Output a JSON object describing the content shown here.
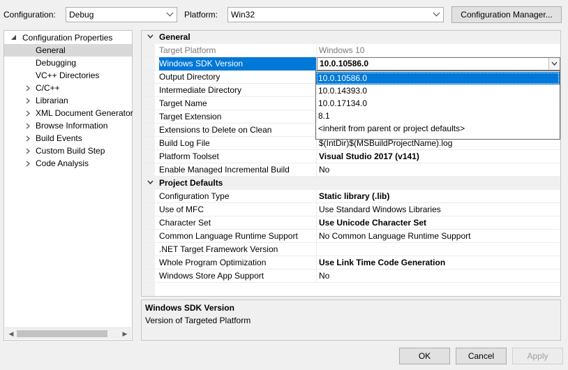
{
  "toolbar": {
    "configuration_label": "Configuration:",
    "configuration_value": "Debug",
    "platform_label": "Platform:",
    "platform_value": "Win32",
    "config_manager_label": "Configuration Manager..."
  },
  "tree": {
    "root": "Configuration Properties",
    "items": [
      {
        "label": "General",
        "selected": true
      },
      {
        "label": "Debugging"
      },
      {
        "label": "VC++ Directories"
      },
      {
        "label": "C/C++"
      },
      {
        "label": "Librarian"
      },
      {
        "label": "XML Document Generator"
      },
      {
        "label": "Browse Information"
      },
      {
        "label": "Build Events"
      },
      {
        "label": "Custom Build Step"
      },
      {
        "label": "Code Analysis"
      }
    ]
  },
  "grid": {
    "general_header": "General",
    "general_rows": [
      {
        "name": "Target Platform",
        "value": "Windows 10"
      },
      {
        "name": "Windows SDK Version",
        "value": "10.0.10586.0"
      },
      {
        "name": "Output Directory",
        "value": ""
      },
      {
        "name": "Intermediate Directory",
        "value": ""
      },
      {
        "name": "Target Name",
        "value": ""
      },
      {
        "name": "Target Extension",
        "value": ""
      },
      {
        "name": "Extensions to Delete on Clean",
        "value": ""
      },
      {
        "name": "Build Log File",
        "value": "$(IntDir)$(MSBuildProjectName).log"
      },
      {
        "name": "Platform Toolset",
        "value": "Visual Studio 2017 (v141)"
      },
      {
        "name": "Enable Managed Incremental Build",
        "value": "No"
      }
    ],
    "defaults_header": "Project Defaults",
    "default_rows": [
      {
        "name": "Configuration Type",
        "value": "Static library (.lib)"
      },
      {
        "name": "Use of MFC",
        "value": "Use Standard Windows Libraries"
      },
      {
        "name": "Character Set",
        "value": "Use Unicode Character Set"
      },
      {
        "name": "Common Language Runtime Support",
        "value": "No Common Language Runtime Support"
      },
      {
        "name": ".NET Target Framework Version",
        "value": ""
      },
      {
        "name": "Whole Program Optimization",
        "value": "Use Link Time Code Generation"
      },
      {
        "name": "Windows Store App Support",
        "value": "No"
      }
    ]
  },
  "sdk_dropdown": {
    "options": [
      "10.0.10586.0",
      "10.0.14393.0",
      "10.0.17134.0",
      "8.1",
      "<inherit from parent or project defaults>"
    ],
    "highlighted": "10.0.10586.0"
  },
  "description": {
    "title": "Windows SDK Version",
    "text": "Version of Targeted Platform"
  },
  "buttons": {
    "ok": "OK",
    "cancel": "Cancel",
    "apply": "Apply"
  },
  "colors": {
    "selection": "#0078d7",
    "tree_selection": "#d9d9d9",
    "window_bg": "#f0f0f0"
  }
}
